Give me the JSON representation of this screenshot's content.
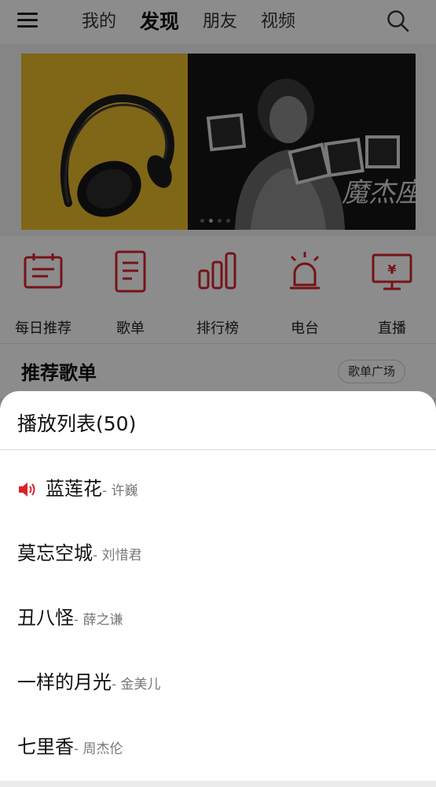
{
  "topbar": {
    "tabs": [
      {
        "label": "我的"
      },
      {
        "label": "发现"
      },
      {
        "label": "朋友"
      },
      {
        "label": "视频"
      }
    ]
  },
  "banner": {
    "album_text": "魔杰座"
  },
  "quick_entries": [
    {
      "label": "每日推荐",
      "icon": "calendar-icon"
    },
    {
      "label": "歌单",
      "icon": "playlist-icon"
    },
    {
      "label": "排行榜",
      "icon": "chart-icon"
    },
    {
      "label": "电台",
      "icon": "radio-icon"
    },
    {
      "label": "直播",
      "icon": "live-tv-icon"
    }
  ],
  "recommended": {
    "title": "推荐歌单",
    "square_label": "歌单广场"
  },
  "playlist": {
    "title": "播放列表(50)",
    "songs": [
      {
        "name": "蓝莲花",
        "artist": "- 许巍",
        "playing": true
      },
      {
        "name": "莫忘空城",
        "artist": "- 刘惜君",
        "playing": false
      },
      {
        "name": "丑八怪",
        "artist": "- 薛之谦",
        "playing": false
      },
      {
        "name": "一样的月光",
        "artist": "- 金美儿",
        "playing": false
      },
      {
        "name": "七里香",
        "artist": "- 周杰伦",
        "playing": false
      }
    ]
  },
  "colors": {
    "accent": "#d8232a",
    "text_primary": "#111111",
    "text_secondary": "#777777"
  }
}
